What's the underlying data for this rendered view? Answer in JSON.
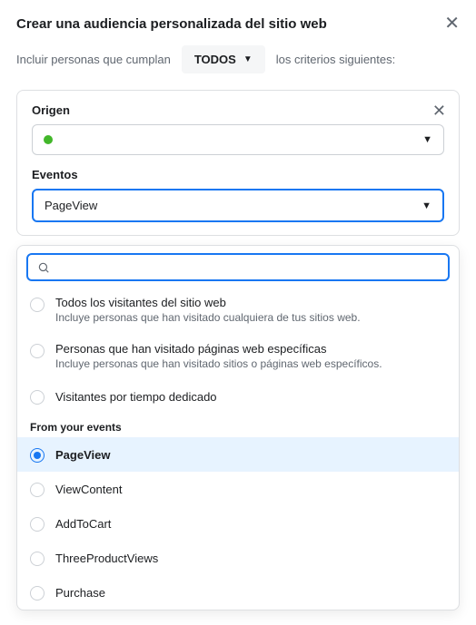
{
  "header": {
    "title": "Crear una audiencia personalizada del sitio web"
  },
  "filter": {
    "prefix": "Incluir personas que cumplan",
    "dropdown_label": "TODOS",
    "suffix": "los criterios siguientes:"
  },
  "card": {
    "origin_label": "Origen",
    "events_label": "Eventos",
    "selected_event": "PageView"
  },
  "dropdown": {
    "search_placeholder": "",
    "options_general": [
      {
        "title": "Todos los visitantes del sitio web",
        "sub": "Incluye personas que han visitado cualquiera de tus sitios web."
      },
      {
        "title": "Personas que han visitado páginas web específicas",
        "sub": "Incluye personas que han visitado sitios o páginas web específicos."
      },
      {
        "title": "Visitantes por tiempo dedicado",
        "sub": ""
      }
    ],
    "events_heading": "From your events",
    "event_options": [
      {
        "title": "PageView",
        "selected": true
      },
      {
        "title": "ViewContent",
        "selected": false
      },
      {
        "title": "AddToCart",
        "selected": false
      },
      {
        "title": "ThreeProductViews",
        "selected": false
      },
      {
        "title": "Purchase",
        "selected": false
      }
    ]
  }
}
